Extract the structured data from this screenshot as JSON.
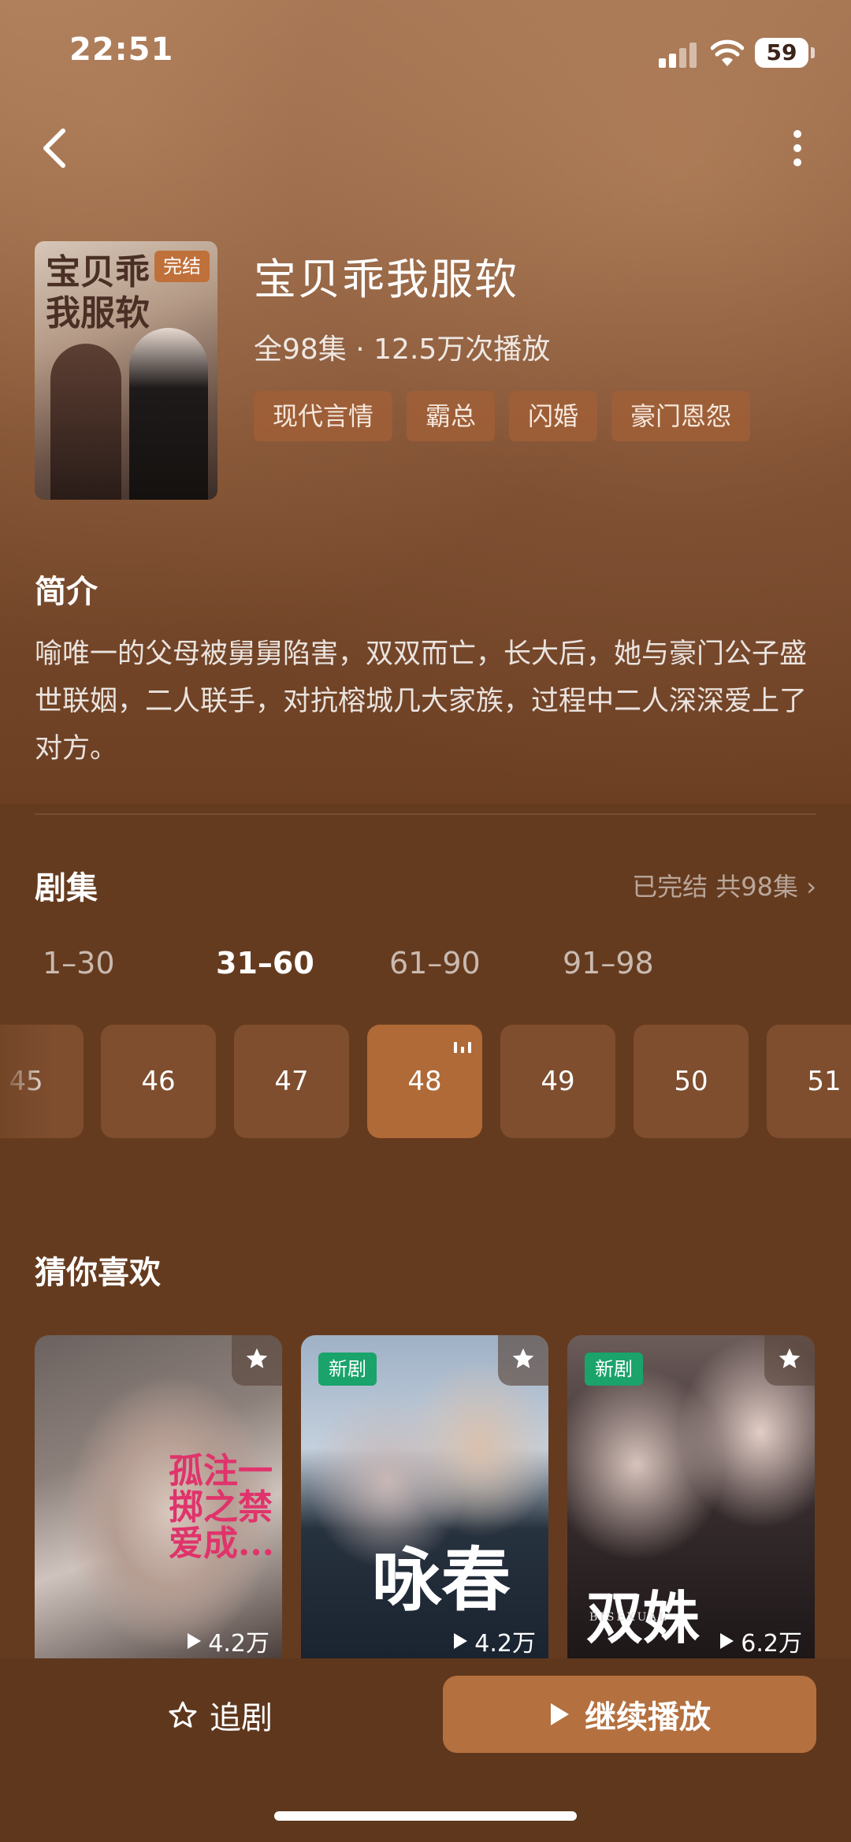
{
  "status_bar": {
    "time": "22:51",
    "battery": "59"
  },
  "show": {
    "cover_title": "宝贝乖我服软",
    "badge": "完结",
    "title": "宝贝乖我服软",
    "meta": "全98集 · 12.5万次播放",
    "tags": [
      "现代言情",
      "霸总",
      "闪婚",
      "豪门恩怨"
    ]
  },
  "synopsis": {
    "heading": "简介",
    "text": "喻唯一的父母被舅舅陷害，双双而亡，长大后，她与豪门公子盛世联姻，二人联手，对抗榕城几大家族，过程中二人深深爱上了对方。"
  },
  "episodes": {
    "heading": "剧集",
    "status": "已完结 共98集 ›",
    "ranges": [
      "1–30",
      "31–60",
      "61–90",
      "91–98"
    ],
    "active_range": "31–60",
    "items": [
      "45",
      "46",
      "47",
      "48",
      "49",
      "50",
      "51"
    ],
    "current": "48"
  },
  "recommend": {
    "heading": "猜你喜欢",
    "items": [
      {
        "badge": "",
        "plays": "4.2万",
        "poster_text": "孤注一掷之禁爱成..."
      },
      {
        "badge": "新剧",
        "plays": "4.2万",
        "poster_text": "咏春"
      },
      {
        "badge": "新剧",
        "plays": "6.2万",
        "poster_text": "双姝",
        "poster_sub": "BISEXUAL"
      }
    ]
  },
  "actions": {
    "follow": "追剧",
    "continue": "继续播放"
  },
  "colors": {
    "accent": "#b4703f",
    "tag_bg": "#a05f37",
    "new_badge": "#1aa36a"
  }
}
